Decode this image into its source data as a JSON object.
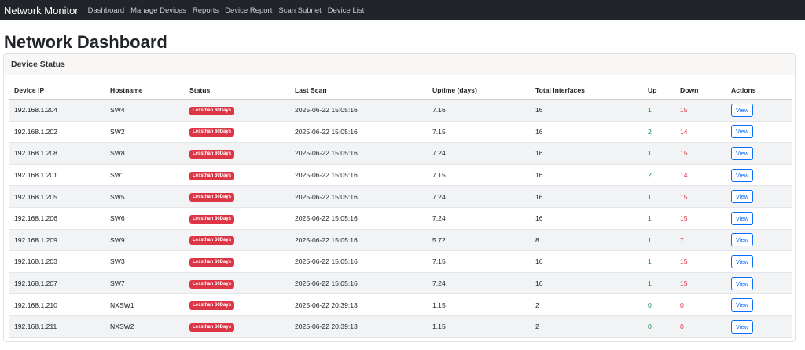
{
  "nav": {
    "brand": "Network Monitor",
    "links": [
      "Dashboard",
      "Manage Devices",
      "Reports",
      "Device Report",
      "Scan Subnet",
      "Device List"
    ]
  },
  "page": {
    "title": "Network Dashboard"
  },
  "card": {
    "title": "Device Status"
  },
  "colors": {
    "badge": "#dc3545",
    "up": "#198754",
    "down": "#dc3545",
    "nav_bg": "#212529",
    "button": "#0d6efd"
  },
  "table": {
    "headers": [
      "Device IP",
      "Hostname",
      "Status",
      "Last Scan",
      "Uptime (days)",
      "Total Interfaces",
      "Up",
      "Down",
      "Actions"
    ],
    "rows": [
      {
        "ip": "192.168.1.204",
        "hostname": "SW4",
        "status": "Lessthan 60Days",
        "last_scan": "2025-06-22 15:05:16",
        "uptime": "7.16",
        "total": "16",
        "up": "1",
        "down": "15",
        "action": "View"
      },
      {
        "ip": "192.168.1.202",
        "hostname": "SW2",
        "status": "Lessthan 60Days",
        "last_scan": "2025-06-22 15:05:16",
        "uptime": "7.15",
        "total": "16",
        "up": "2",
        "down": "14",
        "action": "View"
      },
      {
        "ip": "192.168.1.208",
        "hostname": "SW8",
        "status": "Lessthan 60Days",
        "last_scan": "2025-06-22 15:05:16",
        "uptime": "7.24",
        "total": "16",
        "up": "1",
        "down": "15",
        "action": "View"
      },
      {
        "ip": "192.168.1.201",
        "hostname": "SW1",
        "status": "Lessthan 60Days",
        "last_scan": "2025-06-22 15:05:16",
        "uptime": "7.15",
        "total": "16",
        "up": "2",
        "down": "14",
        "action": "View"
      },
      {
        "ip": "192.168.1.205",
        "hostname": "SW5",
        "status": "Lessthan 60Days",
        "last_scan": "2025-06-22 15:05:16",
        "uptime": "7.24",
        "total": "16",
        "up": "1",
        "down": "15",
        "action": "View"
      },
      {
        "ip": "192.168.1.206",
        "hostname": "SW6",
        "status": "Lessthan 60Days",
        "last_scan": "2025-06-22 15:05:16",
        "uptime": "7.24",
        "total": "16",
        "up": "1",
        "down": "15",
        "action": "View"
      },
      {
        "ip": "192.168.1.209",
        "hostname": "SW9",
        "status": "Lessthan 60Days",
        "last_scan": "2025-06-22 15:05:16",
        "uptime": "5.72",
        "total": "8",
        "up": "1",
        "down": "7",
        "action": "View"
      },
      {
        "ip": "192.168.1.203",
        "hostname": "SW3",
        "status": "Lessthan 60Days",
        "last_scan": "2025-06-22 15:05:16",
        "uptime": "7.15",
        "total": "16",
        "up": "1",
        "down": "15",
        "action": "View"
      },
      {
        "ip": "192.168.1.207",
        "hostname": "SW7",
        "status": "Lessthan 60Days",
        "last_scan": "2025-06-22 15:05:16",
        "uptime": "7.24",
        "total": "16",
        "up": "1",
        "down": "15",
        "action": "View"
      },
      {
        "ip": "192.168.1.210",
        "hostname": "NXSW1",
        "status": "Lessthan 60Days",
        "last_scan": "2025-06-22 20:39:13",
        "uptime": "1.15",
        "total": "2",
        "up": "0",
        "down": "0",
        "action": "View"
      },
      {
        "ip": "192.168.1.211",
        "hostname": "NXSW2",
        "status": "Lessthan 60Days",
        "last_scan": "2025-06-22 20:39:13",
        "uptime": "1.15",
        "total": "2",
        "up": "0",
        "down": "0",
        "action": "View"
      }
    ]
  }
}
